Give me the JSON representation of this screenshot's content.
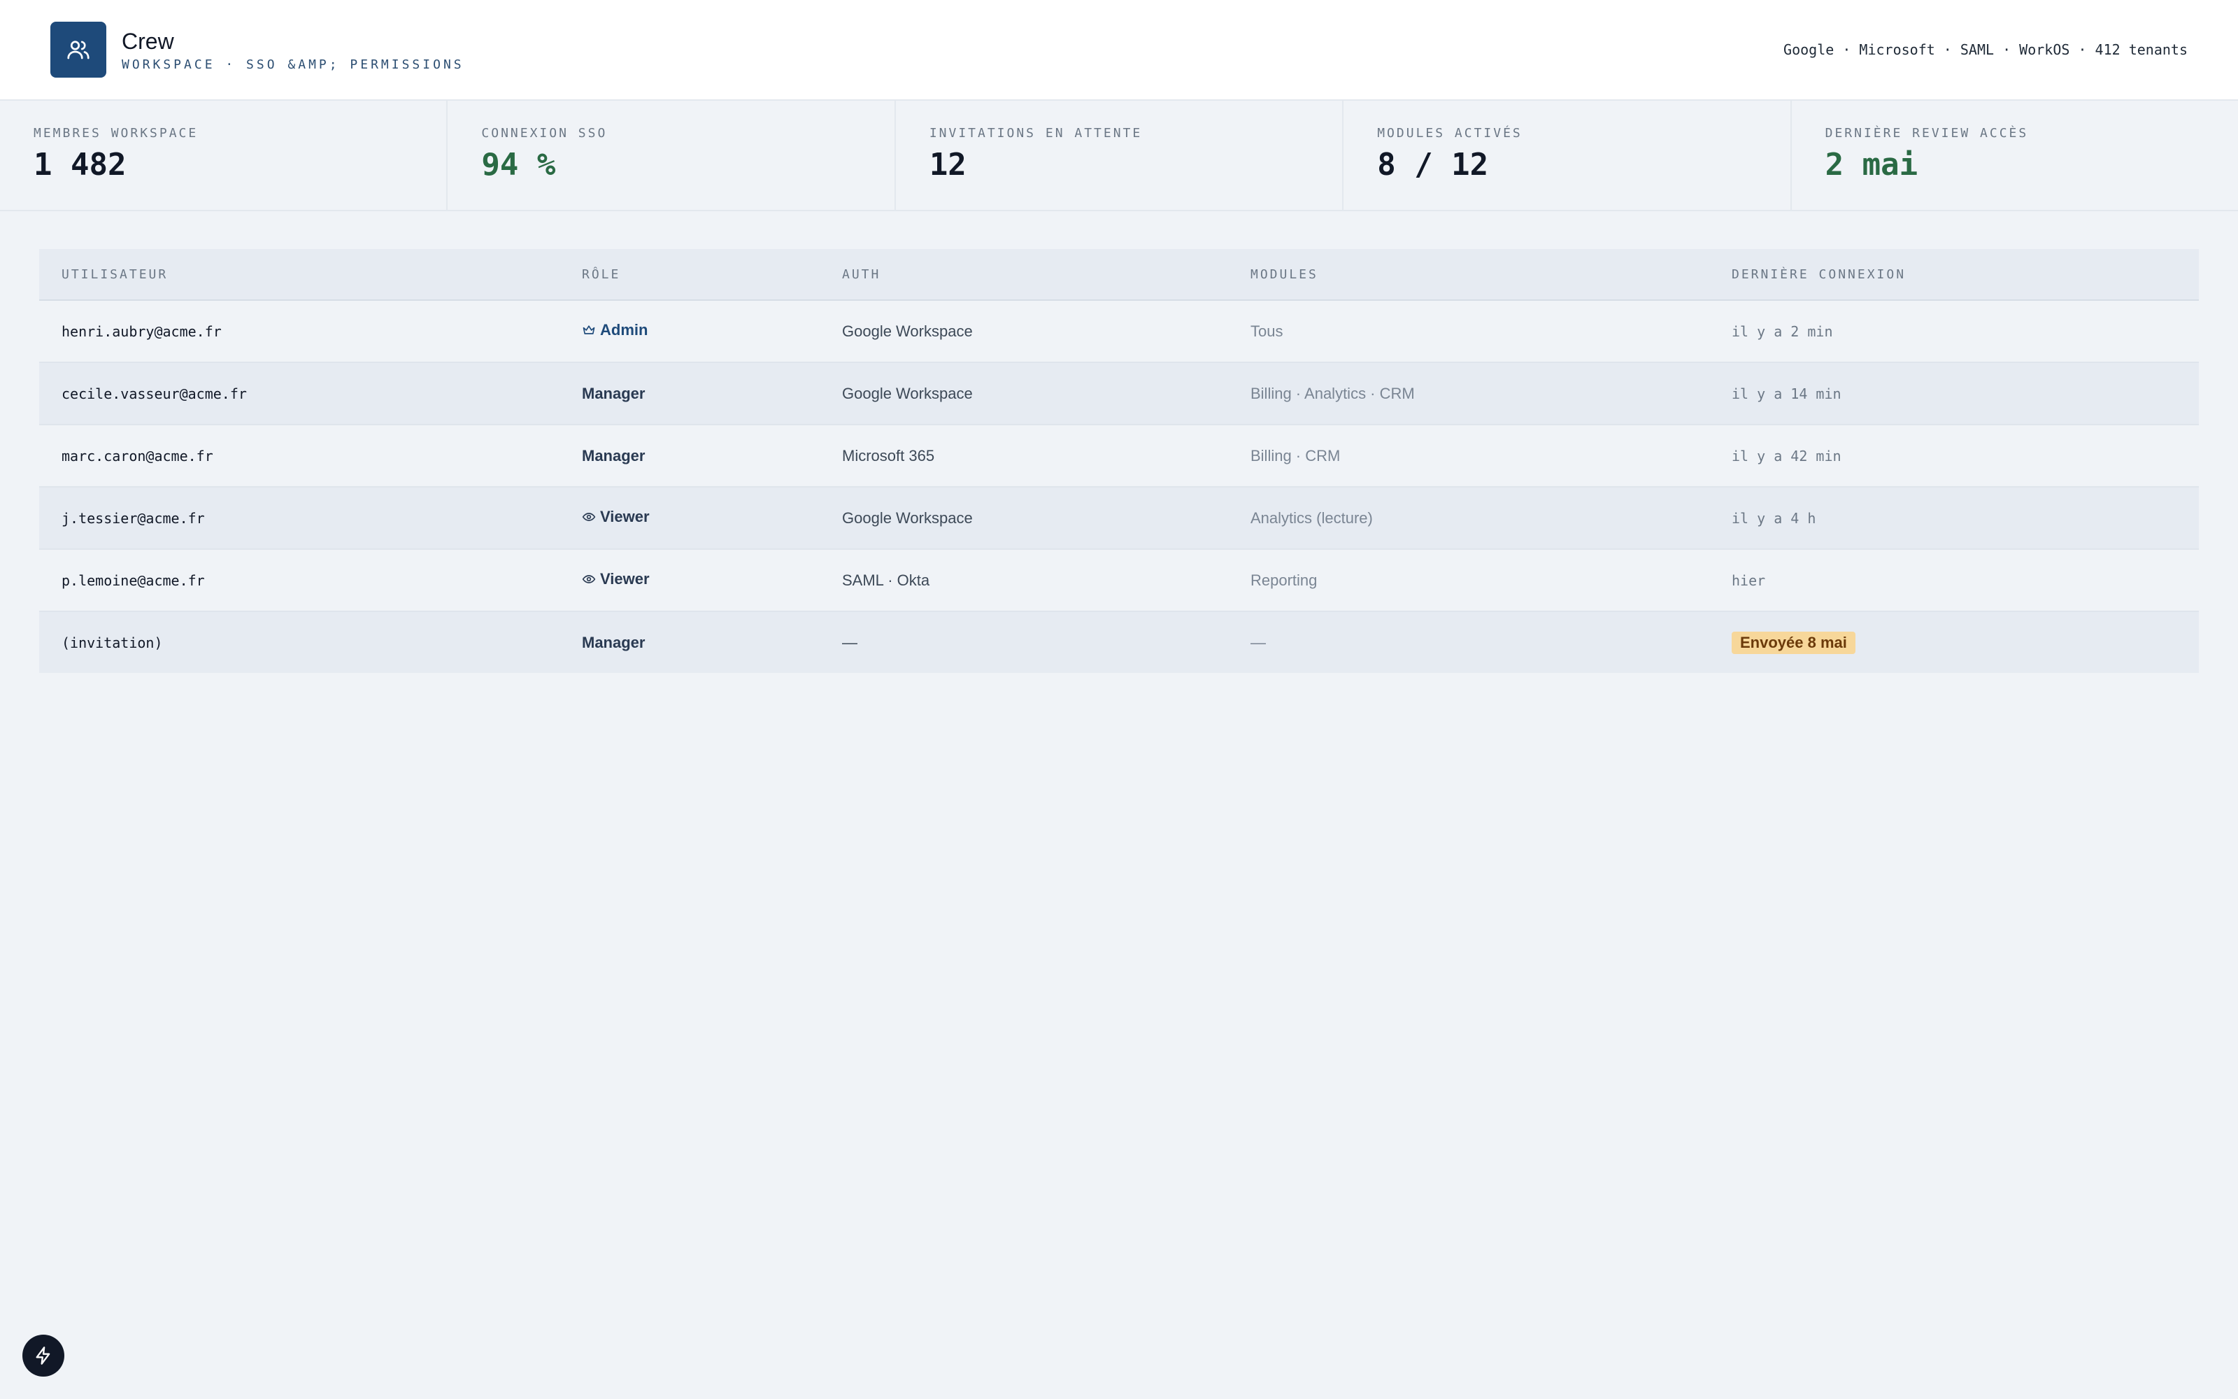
{
  "app": {
    "name": "Crew",
    "subtitle": "WORKSPACE · SSO &AMP; PERMISSIONS",
    "providers": "Google · Microsoft · SAML · WorkOS · 412 tenants"
  },
  "stats": [
    {
      "label": "MEMBRES WORKSPACE",
      "value": "1 482"
    },
    {
      "label": "CONNEXION SSO",
      "value": "94 %"
    },
    {
      "label": "INVITATIONS EN ATTENTE",
      "value": "12"
    },
    {
      "label": "MODULES ACTIVÉS",
      "value": "8 / 12"
    },
    {
      "label": "DERNIÈRE REVIEW ACCÈS",
      "value": "2 mai"
    }
  ],
  "table": {
    "headers": [
      "UTILISATEUR",
      "RÔLE",
      "AUTH",
      "MODULES",
      "DERNIÈRE CONNEXION"
    ],
    "rows": [
      {
        "user": "henri.aubry@acme.fr",
        "role": "Admin",
        "role_icon": "crown-icon",
        "auth": "Google Workspace",
        "modules": "Tous",
        "last": "il y a 2 min"
      },
      {
        "user": "cecile.vasseur@acme.fr",
        "role": "Manager",
        "auth": "Google Workspace",
        "modules": "Billing · Analytics · CRM",
        "last": "il y a 14 min"
      },
      {
        "user": "marc.caron@acme.fr",
        "role": "Manager",
        "auth": "Microsoft 365",
        "modules": "Billing · CRM",
        "last": "il y a 42 min"
      },
      {
        "user": "j.tessier@acme.fr",
        "role": "Viewer",
        "role_icon": "eye-icon",
        "auth": "Google Workspace",
        "modules": "Analytics (lecture)",
        "last": "il y a 4 h"
      },
      {
        "user": "p.lemoine@acme.fr",
        "role": "Viewer",
        "role_icon": "eye-icon",
        "auth": "SAML · Okta",
        "modules": "Reporting",
        "last": "hier"
      },
      {
        "user": "(invitation)",
        "role": "Manager",
        "auth": "—",
        "modules": "—",
        "last": "Envoyée 8 mai"
      }
    ]
  },
  "colors": {
    "brand": "#1e4a7a",
    "positive": "#2a6a44",
    "pending_badge_bg": "#f7d79a"
  }
}
